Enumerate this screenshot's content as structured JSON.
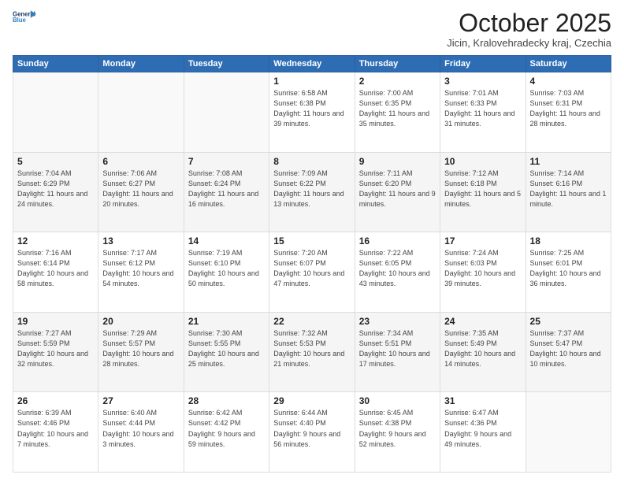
{
  "header": {
    "logo_line1": "General",
    "logo_line2": "Blue",
    "month": "October 2025",
    "location": "Jicin, Kralovehradecky kraj, Czechia"
  },
  "days_of_week": [
    "Sunday",
    "Monday",
    "Tuesday",
    "Wednesday",
    "Thursday",
    "Friday",
    "Saturday"
  ],
  "weeks": [
    [
      {
        "num": "",
        "info": ""
      },
      {
        "num": "",
        "info": ""
      },
      {
        "num": "",
        "info": ""
      },
      {
        "num": "1",
        "info": "Sunrise: 6:58 AM\nSunset: 6:38 PM\nDaylight: 11 hours\nand 39 minutes."
      },
      {
        "num": "2",
        "info": "Sunrise: 7:00 AM\nSunset: 6:35 PM\nDaylight: 11 hours\nand 35 minutes."
      },
      {
        "num": "3",
        "info": "Sunrise: 7:01 AM\nSunset: 6:33 PM\nDaylight: 11 hours\nand 31 minutes."
      },
      {
        "num": "4",
        "info": "Sunrise: 7:03 AM\nSunset: 6:31 PM\nDaylight: 11 hours\nand 28 minutes."
      }
    ],
    [
      {
        "num": "5",
        "info": "Sunrise: 7:04 AM\nSunset: 6:29 PM\nDaylight: 11 hours\nand 24 minutes."
      },
      {
        "num": "6",
        "info": "Sunrise: 7:06 AM\nSunset: 6:27 PM\nDaylight: 11 hours\nand 20 minutes."
      },
      {
        "num": "7",
        "info": "Sunrise: 7:08 AM\nSunset: 6:24 PM\nDaylight: 11 hours\nand 16 minutes."
      },
      {
        "num": "8",
        "info": "Sunrise: 7:09 AM\nSunset: 6:22 PM\nDaylight: 11 hours\nand 13 minutes."
      },
      {
        "num": "9",
        "info": "Sunrise: 7:11 AM\nSunset: 6:20 PM\nDaylight: 11 hours\nand 9 minutes."
      },
      {
        "num": "10",
        "info": "Sunrise: 7:12 AM\nSunset: 6:18 PM\nDaylight: 11 hours\nand 5 minutes."
      },
      {
        "num": "11",
        "info": "Sunrise: 7:14 AM\nSunset: 6:16 PM\nDaylight: 11 hours\nand 1 minute."
      }
    ],
    [
      {
        "num": "12",
        "info": "Sunrise: 7:16 AM\nSunset: 6:14 PM\nDaylight: 10 hours\nand 58 minutes."
      },
      {
        "num": "13",
        "info": "Sunrise: 7:17 AM\nSunset: 6:12 PM\nDaylight: 10 hours\nand 54 minutes."
      },
      {
        "num": "14",
        "info": "Sunrise: 7:19 AM\nSunset: 6:10 PM\nDaylight: 10 hours\nand 50 minutes."
      },
      {
        "num": "15",
        "info": "Sunrise: 7:20 AM\nSunset: 6:07 PM\nDaylight: 10 hours\nand 47 minutes."
      },
      {
        "num": "16",
        "info": "Sunrise: 7:22 AM\nSunset: 6:05 PM\nDaylight: 10 hours\nand 43 minutes."
      },
      {
        "num": "17",
        "info": "Sunrise: 7:24 AM\nSunset: 6:03 PM\nDaylight: 10 hours\nand 39 minutes."
      },
      {
        "num": "18",
        "info": "Sunrise: 7:25 AM\nSunset: 6:01 PM\nDaylight: 10 hours\nand 36 minutes."
      }
    ],
    [
      {
        "num": "19",
        "info": "Sunrise: 7:27 AM\nSunset: 5:59 PM\nDaylight: 10 hours\nand 32 minutes."
      },
      {
        "num": "20",
        "info": "Sunrise: 7:29 AM\nSunset: 5:57 PM\nDaylight: 10 hours\nand 28 minutes."
      },
      {
        "num": "21",
        "info": "Sunrise: 7:30 AM\nSunset: 5:55 PM\nDaylight: 10 hours\nand 25 minutes."
      },
      {
        "num": "22",
        "info": "Sunrise: 7:32 AM\nSunset: 5:53 PM\nDaylight: 10 hours\nand 21 minutes."
      },
      {
        "num": "23",
        "info": "Sunrise: 7:34 AM\nSunset: 5:51 PM\nDaylight: 10 hours\nand 17 minutes."
      },
      {
        "num": "24",
        "info": "Sunrise: 7:35 AM\nSunset: 5:49 PM\nDaylight: 10 hours\nand 14 minutes."
      },
      {
        "num": "25",
        "info": "Sunrise: 7:37 AM\nSunset: 5:47 PM\nDaylight: 10 hours\nand 10 minutes."
      }
    ],
    [
      {
        "num": "26",
        "info": "Sunrise: 6:39 AM\nSunset: 4:46 PM\nDaylight: 10 hours\nand 7 minutes."
      },
      {
        "num": "27",
        "info": "Sunrise: 6:40 AM\nSunset: 4:44 PM\nDaylight: 10 hours\nand 3 minutes."
      },
      {
        "num": "28",
        "info": "Sunrise: 6:42 AM\nSunset: 4:42 PM\nDaylight: 9 hours\nand 59 minutes."
      },
      {
        "num": "29",
        "info": "Sunrise: 6:44 AM\nSunset: 4:40 PM\nDaylight: 9 hours\nand 56 minutes."
      },
      {
        "num": "30",
        "info": "Sunrise: 6:45 AM\nSunset: 4:38 PM\nDaylight: 9 hours\nand 52 minutes."
      },
      {
        "num": "31",
        "info": "Sunrise: 6:47 AM\nSunset: 4:36 PM\nDaylight: 9 hours\nand 49 minutes."
      },
      {
        "num": "",
        "info": ""
      }
    ]
  ]
}
